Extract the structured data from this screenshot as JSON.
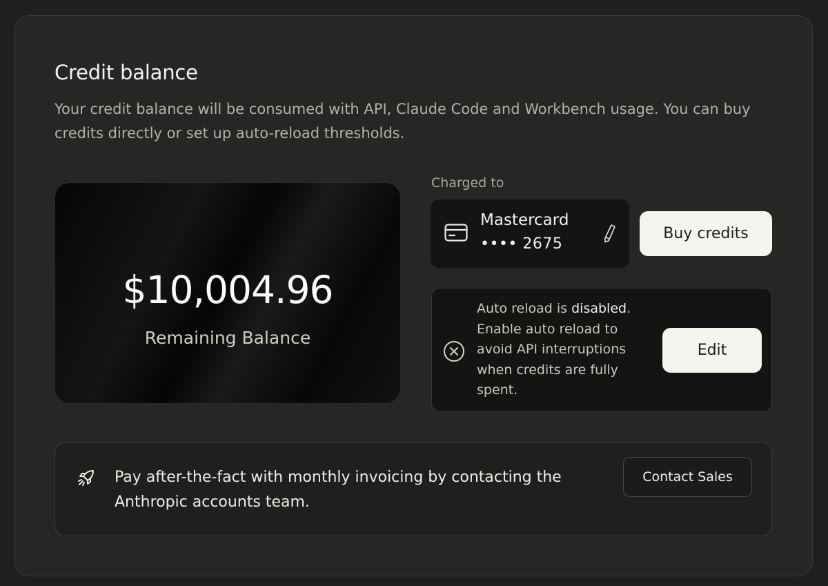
{
  "section": {
    "title": "Credit balance",
    "description": "Your credit balance will be consumed with API, Claude Code and Workbench usage. You can buy credits directly or set up auto-reload thresholds."
  },
  "balance": {
    "amount": "$10,004.96",
    "label": "Remaining Balance"
  },
  "payment": {
    "charged_to_label": "Charged to",
    "card_brand": "Mastercard",
    "card_number": "•••• 2675",
    "buy_button": "Buy credits",
    "icons": [
      "credit-card-icon",
      "pencil-icon"
    ]
  },
  "auto_reload": {
    "prefix": "Auto reload is ",
    "status": "disabled",
    "suffix": ". Enable auto reload to avoid API interruptions when credits are fully spent.",
    "edit_button": "Edit",
    "icon": "circle-x-icon"
  },
  "invoicing": {
    "text": "Pay after-the-fact with monthly invoicing by contacting the Anthropic accounts team.",
    "contact_button": "Contact Sales",
    "icon": "rocket-icon"
  }
}
